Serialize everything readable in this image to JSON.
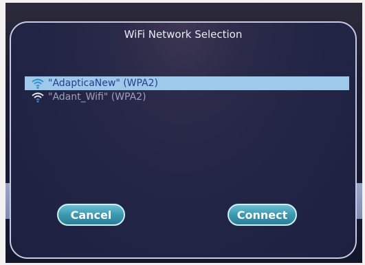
{
  "dialog": {
    "title": "WiFi Network Selection"
  },
  "networks": [
    {
      "ssid": "\"AdapticaNew\" (WPA2)",
      "selected": true,
      "icon": "wifi-icon"
    },
    {
      "ssid": "\"Adant_Wifi\" (WPA2)",
      "selected": false,
      "icon": "wifi-icon"
    }
  ],
  "buttons": {
    "cancel_label": "Cancel",
    "connect_label": "Connect"
  },
  "colors": {
    "selection": "#9fc9ea",
    "button": "#3c98b0"
  }
}
